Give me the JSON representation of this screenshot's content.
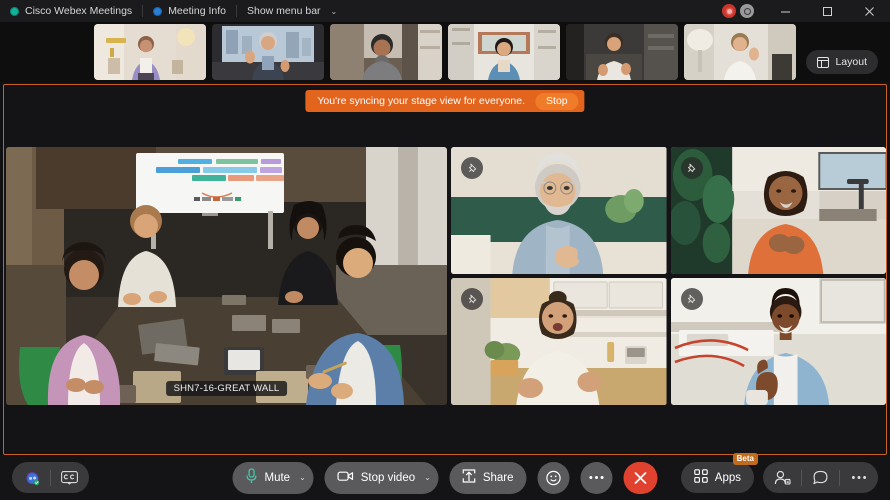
{
  "titlebar": {
    "app_name": "Cisco Webex Meetings",
    "meeting_info": "Meeting Info",
    "show_menu_bar": "Show menu bar",
    "caret": "⌄",
    "record_icon": "record-icon",
    "network_icon": "network-status-icon",
    "minimize_label": "Minimize",
    "maximize_label": "Maximize",
    "close_label": "Close"
  },
  "filmstrip": {
    "layout_label": "Layout",
    "tiles": [
      {
        "name": "participant-thumb-1"
      },
      {
        "name": "participant-thumb-2"
      },
      {
        "name": "participant-thumb-3"
      },
      {
        "name": "participant-thumb-4"
      },
      {
        "name": "participant-thumb-5"
      },
      {
        "name": "participant-thumb-6"
      }
    ]
  },
  "stage": {
    "border_color": "#c8622a",
    "banner": {
      "message": "You're syncing your stage view for everyone.",
      "stop_label": "Stop",
      "background": "#e2641d",
      "stop_background": "#f07c2a"
    },
    "main_video": {
      "name_label": "SHN7-16-GREAT WALL"
    },
    "sub_videos": [
      {
        "name": "stage-video-2",
        "pin": "pin-icon"
      },
      {
        "name": "stage-video-3",
        "pin": "pin-icon"
      },
      {
        "name": "stage-video-4",
        "pin": "pin-icon"
      },
      {
        "name": "stage-video-5",
        "pin": "pin-icon"
      }
    ]
  },
  "toolbar": {
    "assistant_icon": "webex-ai-assistant-icon",
    "captions_icon": "closed-captions-icon",
    "mute_label": "Mute",
    "mute_caret": "⌄",
    "video_label": "Stop video",
    "video_caret": "⌄",
    "share_label": "Share",
    "reactions_icon": "emoji-reaction-icon",
    "more_icon": "more-options-icon",
    "leave_icon": "leave-meeting-icon",
    "apps_label": "Apps",
    "apps_badge": "Beta",
    "participants_icon": "participants-icon",
    "chat_icon": "chat-icon",
    "more_panel_icon": "more-panel-icon",
    "mic_accent": "#3ec9a7",
    "leave_color": "#e0422f"
  }
}
